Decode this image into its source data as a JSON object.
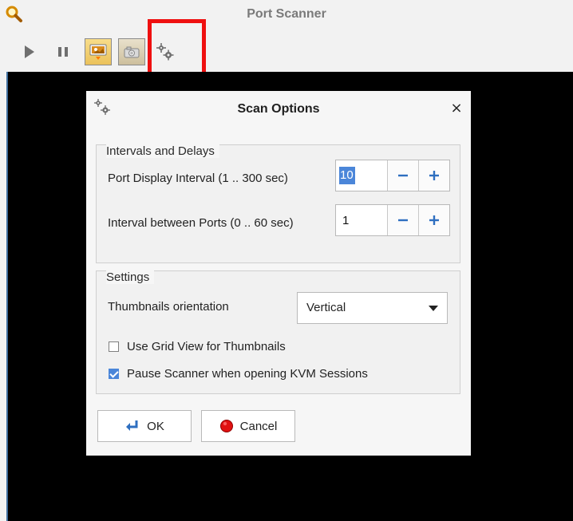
{
  "window": {
    "title": "Port Scanner",
    "logo_icon": "magnifier-icon"
  },
  "toolbar": {
    "play_icon": "play-icon",
    "pause_icon": "pause-icon",
    "view_a_icon": "thumbnail-view-icon",
    "view_b_icon": "camera-icon",
    "options_icon": "gear-icon",
    "highlight_color": "#ef1010"
  },
  "dialog": {
    "title": "Scan Options",
    "title_icon": "gear-icon",
    "close_label": "×",
    "intervals_group": {
      "title": "Intervals and Delays",
      "rows": [
        {
          "label": "Port Display Interval (1 .. 300 sec)",
          "value": "10"
        },
        {
          "label": "Interval between Ports (0 .. 60 sec)",
          "value": "1"
        }
      ]
    },
    "settings_group": {
      "title": "Settings",
      "orientation_label": "Thumbnails orientation",
      "orientation_value": "Vertical",
      "grid_view_label": "Use Grid View for Thumbnails",
      "grid_view_checked": false,
      "pause_scanner_label": "Pause Scanner when opening KVM Sessions",
      "pause_scanner_checked": true
    },
    "buttons": {
      "ok_label": "OK",
      "cancel_label": "Cancel"
    }
  },
  "colors": {
    "accent": "#4b86d9",
    "cancel_icon": "#e01212",
    "ok_icon": "#2e6fc0"
  }
}
